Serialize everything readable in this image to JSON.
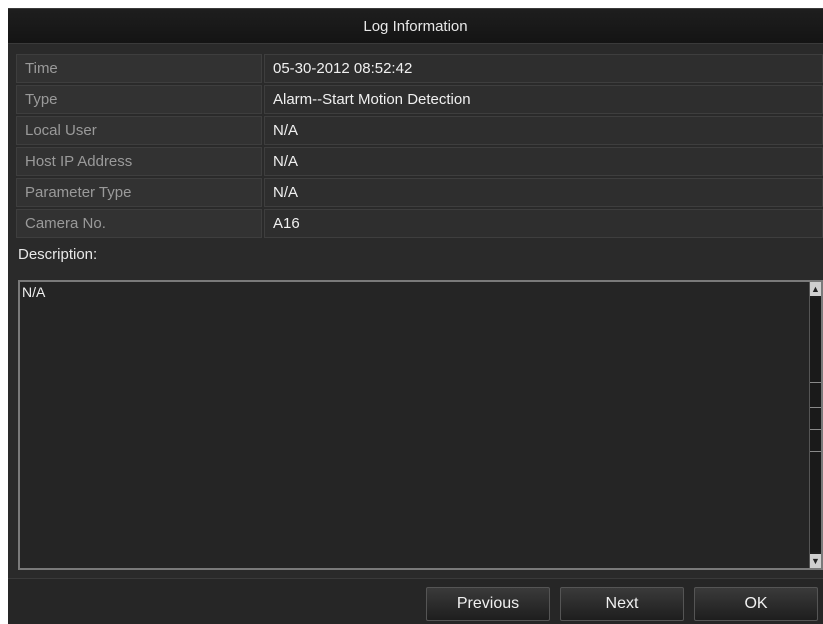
{
  "dialog": {
    "title": "Log Information"
  },
  "fields": [
    {
      "label": "Time",
      "value": "05-30-2012 08:52:42"
    },
    {
      "label": "Type",
      "value": "Alarm--Start Motion Detection"
    },
    {
      "label": "Local User",
      "value": "N/A"
    },
    {
      "label": "Host IP Address",
      "value": "N/A"
    },
    {
      "label": "Parameter Type",
      "value": "N/A"
    },
    {
      "label": "Camera No.",
      "value": "A16"
    }
  ],
  "description": {
    "label": "Description:",
    "text": "N/A"
  },
  "buttons": {
    "previous": "Previous",
    "next": "Next",
    "ok": "OK"
  },
  "icons": {
    "scroll_up": "chevron-up-icon",
    "scroll_down": "chevron-down-icon"
  }
}
